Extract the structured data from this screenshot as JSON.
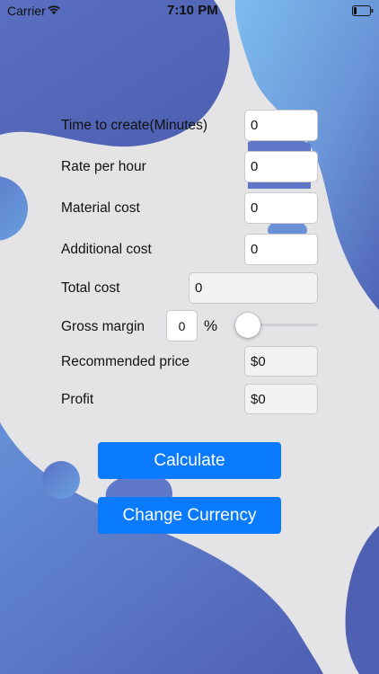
{
  "status_bar": {
    "carrier": "Carrier",
    "time": "7:10 PM",
    "wifi_icon": "wifi-icon",
    "battery_icon": "battery-icon"
  },
  "form": {
    "time_to_create": {
      "label": "Time to create(Minutes)",
      "value": "0"
    },
    "rate_per_hour": {
      "label": "Rate per hour",
      "value": "0"
    },
    "material_cost": {
      "label": "Material cost",
      "value": "0"
    },
    "additional_cost": {
      "label": "Additional cost",
      "value": "0"
    },
    "total_cost": {
      "label": "Total cost",
      "value": "0"
    },
    "gross_margin": {
      "label": "Gross margin",
      "value": "0",
      "unit": "%",
      "slider_fraction": 0
    },
    "recommended_price": {
      "label": "Recommended price",
      "value": "$0"
    },
    "profit": {
      "label": "Profit",
      "value": "$0"
    }
  },
  "buttons": {
    "calculate": "Calculate",
    "change_currency": "Change Currency"
  },
  "colors": {
    "accent": "#0a7aff",
    "background": "#e4e4e6",
    "blob_dark": "#5468b8",
    "blob_light": "#74aee8"
  }
}
